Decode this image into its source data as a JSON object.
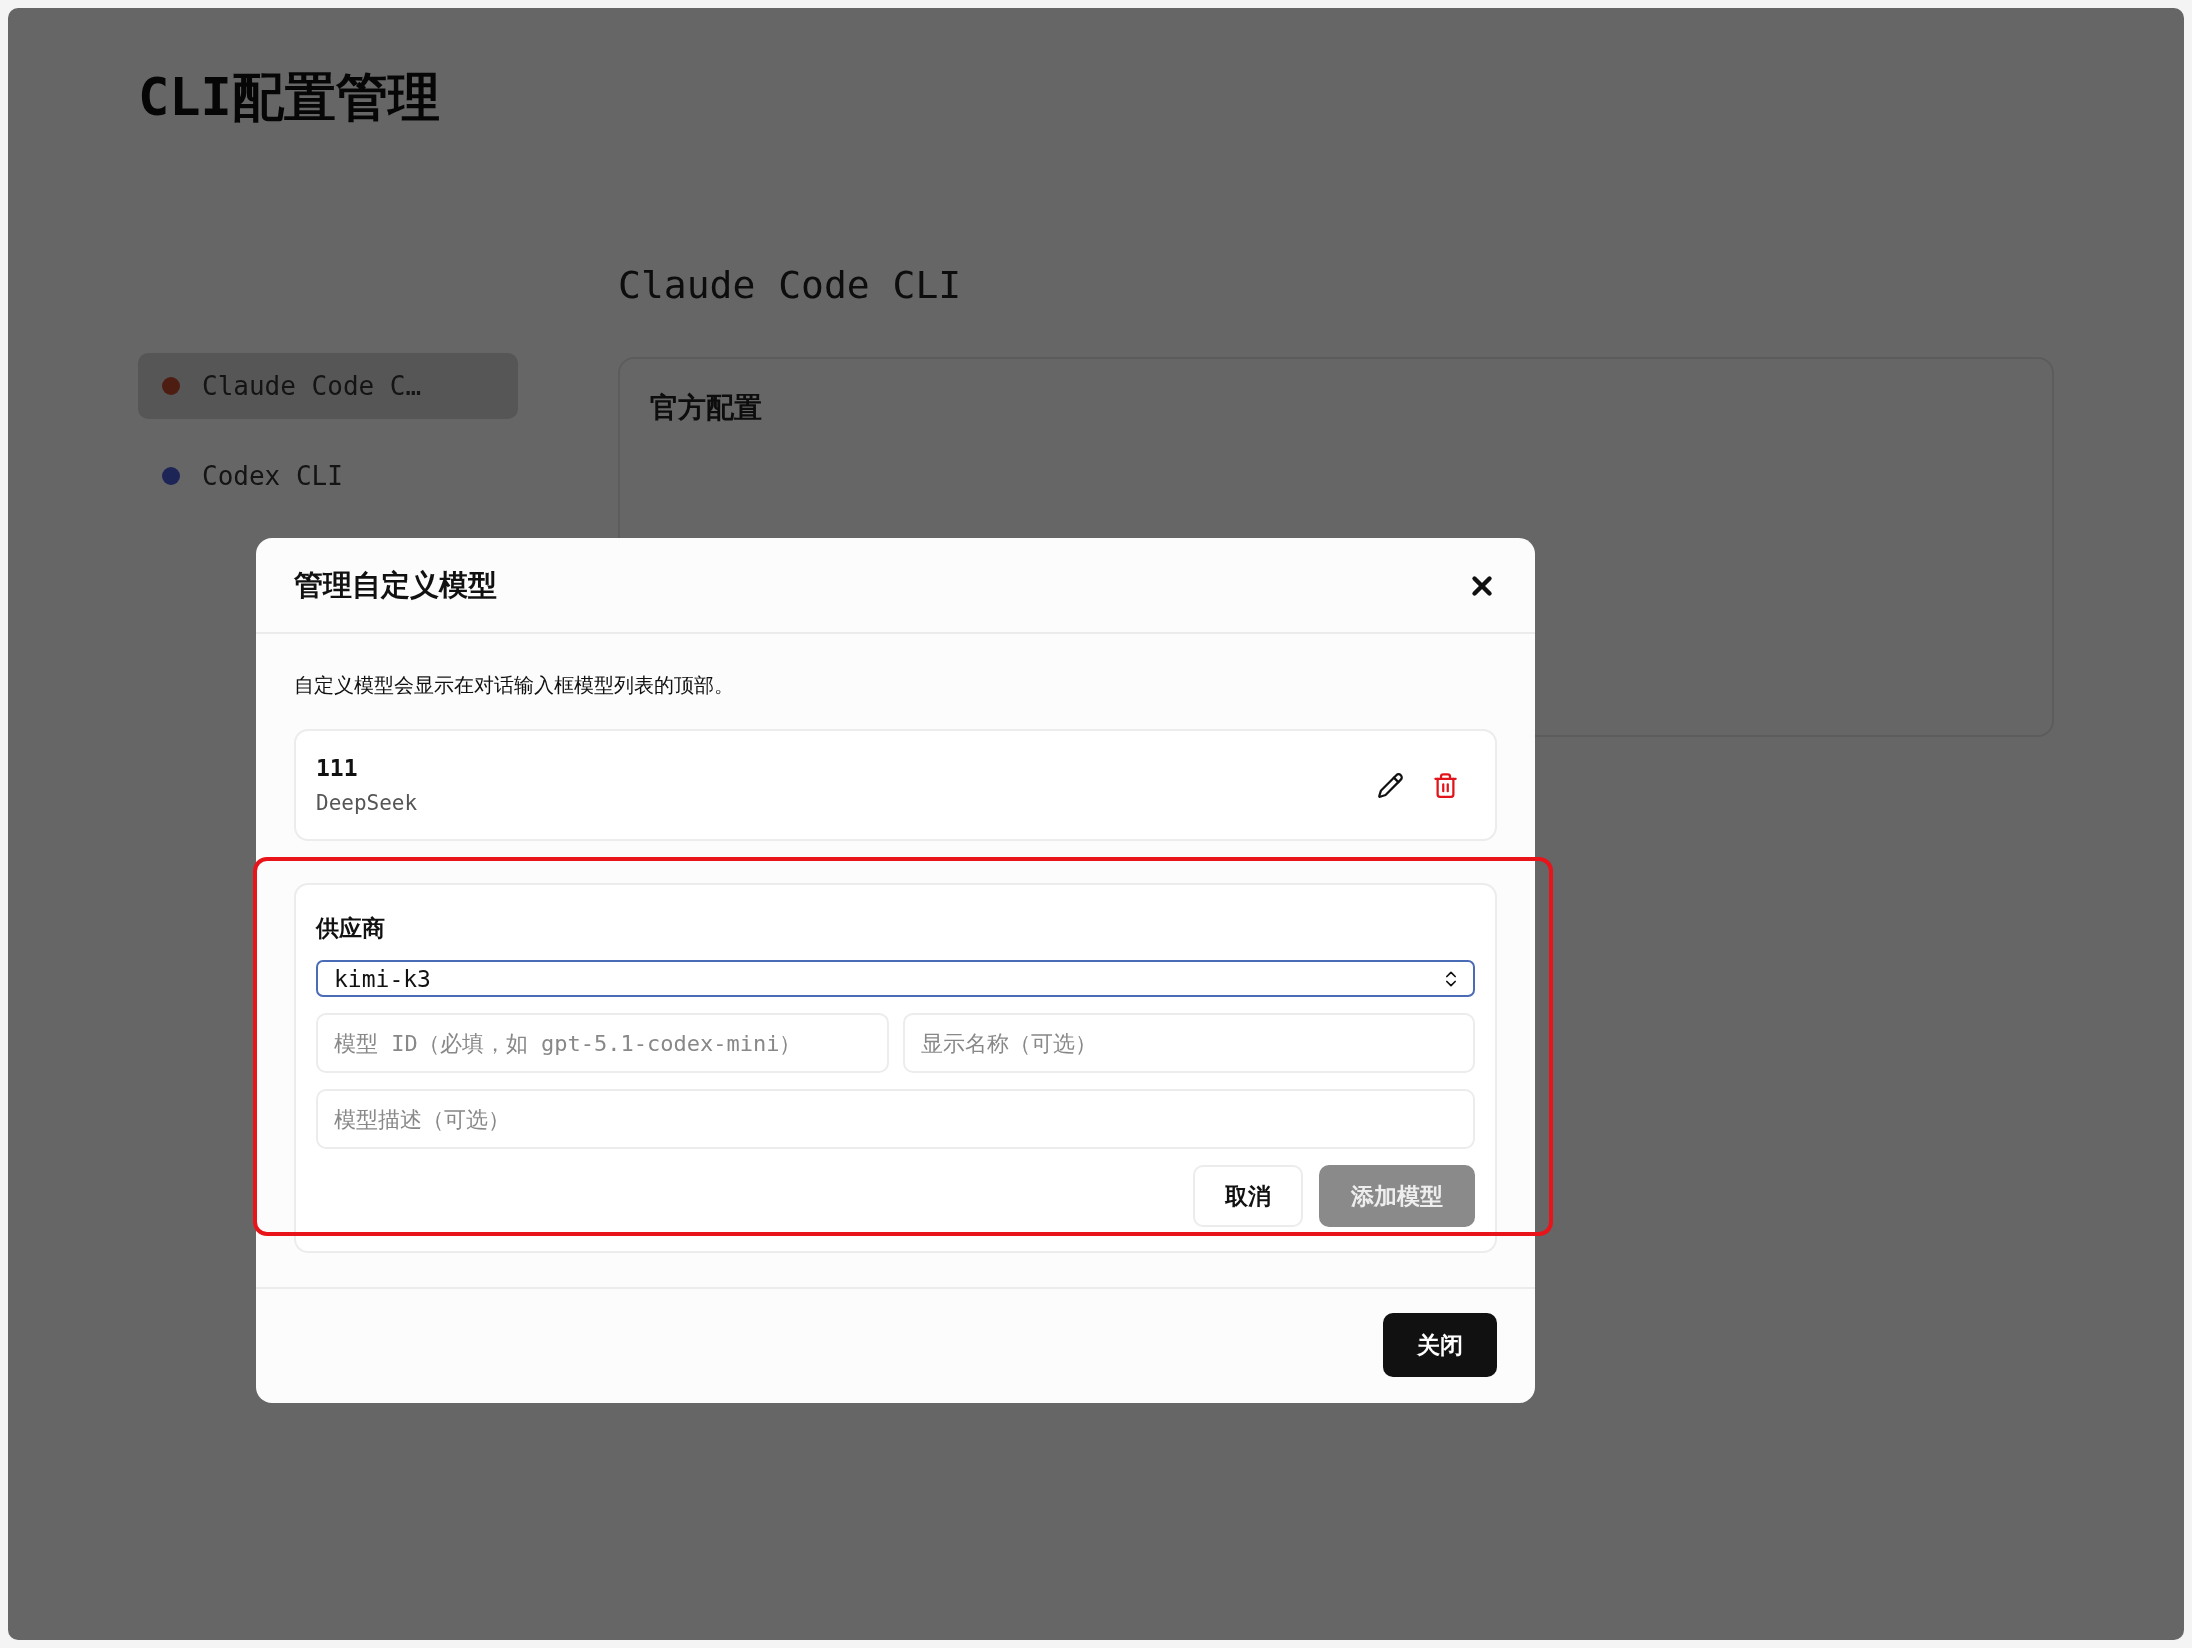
{
  "page": {
    "title": "CLI配置管理"
  },
  "sidebar": {
    "items": [
      {
        "label": "Claude Code C…",
        "selected": true
      },
      {
        "label": "Codex CLI",
        "selected": false
      }
    ]
  },
  "main": {
    "cli_title": "Claude Code CLI",
    "section_title": "官方配置"
  },
  "dialog": {
    "title": "管理自定义模型",
    "description": "自定义模型会显示在对话输入框模型列表的顶部。",
    "models": [
      {
        "name": "111",
        "provider": "DeepSeek"
      }
    ],
    "form": {
      "highlighted": true,
      "provider_label": "供应商",
      "provider_value": "kimi-k3",
      "model_id_placeholder": "模型 ID（必填，如 gpt-5.1-codex-mini）",
      "display_name_placeholder": "显示名称（可选）",
      "description_placeholder": "模型描述（可选）",
      "cancel": "取消",
      "submit": "添加模型",
      "submit_disabled": true
    },
    "close_button": "关闭"
  }
}
